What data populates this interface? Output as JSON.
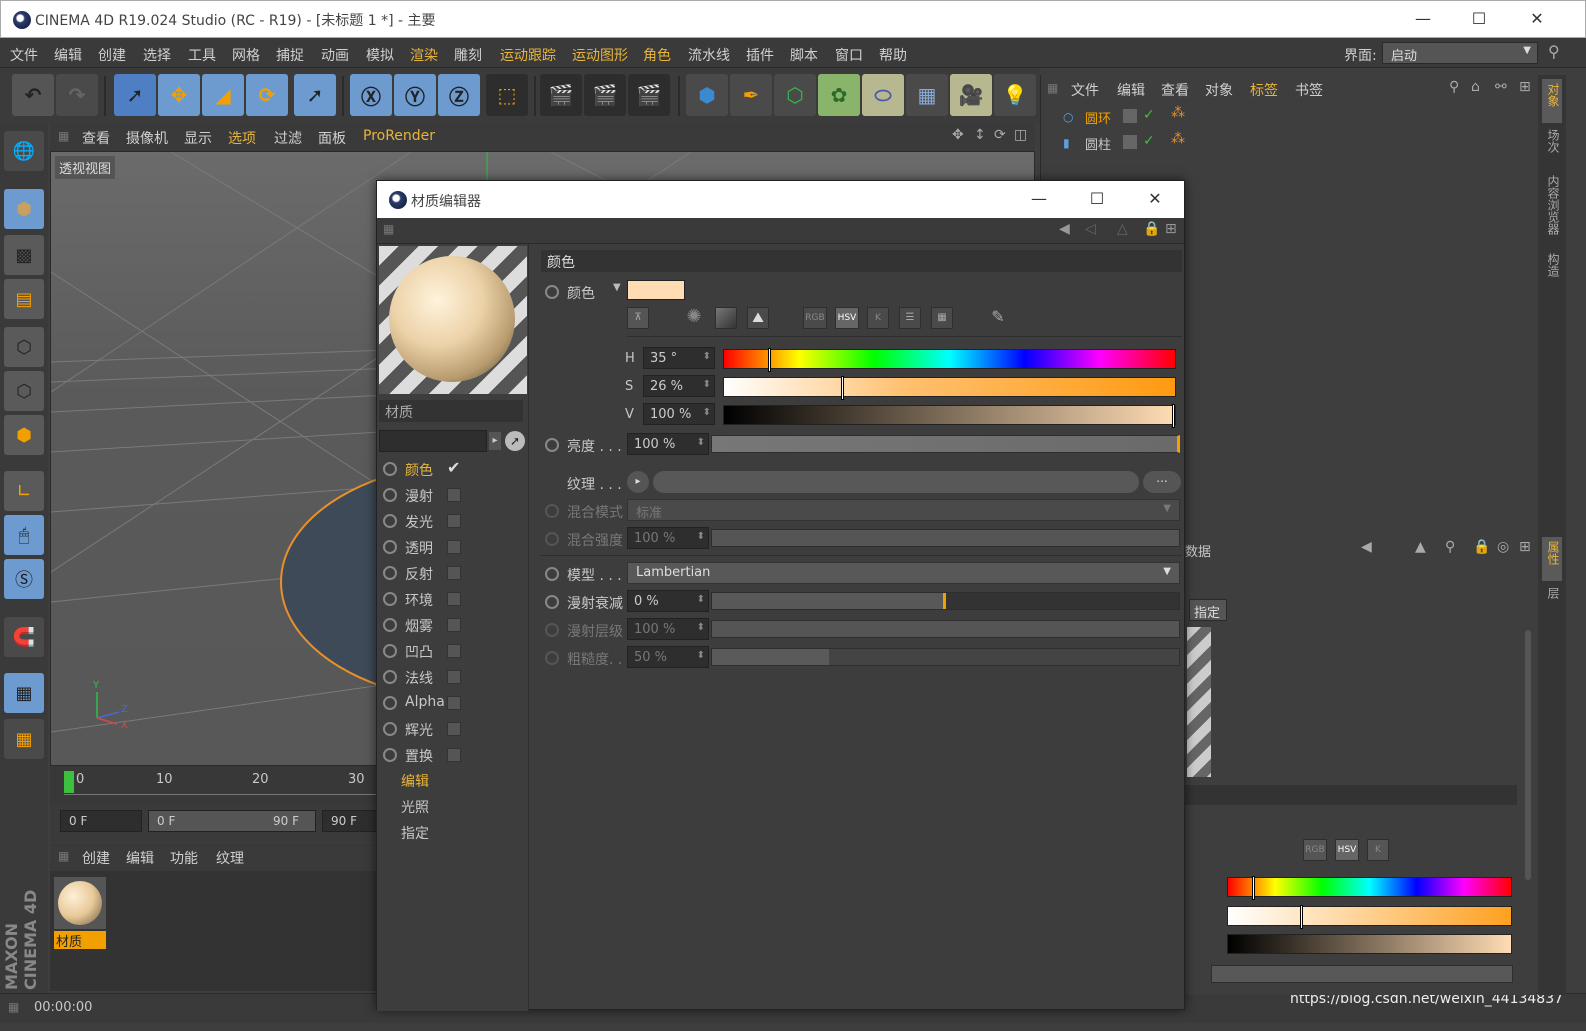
{
  "app": {
    "title": "CINEMA 4D R19.024 Studio (RC - R19) - [未标题 1 *] - 主要",
    "min": "—",
    "max": "☐",
    "close": "✕"
  },
  "menubar": {
    "items": [
      "文件",
      "编辑",
      "创建",
      "选择",
      "工具",
      "网格",
      "捕捉",
      "动画",
      "模拟",
      "渲染",
      "雕刻",
      "运动跟踪",
      "运动图形",
      "角色",
      "流水线",
      "插件",
      "脚本",
      "窗口",
      "帮助"
    ],
    "layout_label": "界面:",
    "layout_value": "启动"
  },
  "viewport": {
    "menu": [
      "查看",
      "摄像机",
      "显示",
      "选项",
      "过滤",
      "面板",
      "ProRender"
    ],
    "label": "透视视图",
    "axis_y": "Y",
    "axis_z": "Z",
    "axis_x": "X"
  },
  "timeline": {
    "ticks": [
      "0",
      "10",
      "20",
      "30"
    ],
    "start_field": "0 F",
    "range_start": "0 F",
    "range_end": "90 F",
    "end_field": "90 F"
  },
  "material_manager": {
    "menu": [
      "创建",
      "编辑",
      "功能",
      "纹理"
    ],
    "material_name": "材质"
  },
  "statusbar": {
    "time": "00:00:00",
    "watermark": "https://blog.csdn.net/weixin_44134837"
  },
  "object_manager": {
    "menu": [
      "文件",
      "编辑",
      "查看",
      "对象",
      "标签",
      "书签"
    ],
    "objects": [
      {
        "name": "圆环",
        "icon": "torus-icon",
        "selected": true
      },
      {
        "name": "圆柱",
        "icon": "cylinder-icon",
        "selected": false
      }
    ]
  },
  "attribute_manager": {
    "title_fragment": "数据",
    "assign_button": "指定",
    "rgb": "RGB",
    "hsv": "HSV",
    "k": "K"
  },
  "right_tabs": [
    "对象",
    "场次",
    "内容浏览器",
    "构造",
    "属性",
    "层"
  ],
  "material_editor": {
    "title": "材质编辑器",
    "min": "—",
    "max": "☐",
    "close": "✕",
    "material_name": "材质",
    "channels": [
      {
        "label": "颜色",
        "checked": true,
        "active": true
      },
      {
        "label": "漫射",
        "checked": false
      },
      {
        "label": "发光",
        "checked": false
      },
      {
        "label": "透明",
        "checked": false
      },
      {
        "label": "反射",
        "checked": false
      },
      {
        "label": "环境",
        "checked": false
      },
      {
        "label": "烟雾",
        "checked": false
      },
      {
        "label": "凹凸",
        "checked": false
      },
      {
        "label": "法线",
        "checked": false
      },
      {
        "label": "Alpha",
        "checked": false
      },
      {
        "label": "辉光",
        "checked": false
      },
      {
        "label": "置换",
        "checked": false
      }
    ],
    "links": [
      "编辑",
      "光照",
      "指定"
    ],
    "section_title": "颜色",
    "color_label": "颜色",
    "swatch_color": "#ffdcb4",
    "rgb": "RGB",
    "hsv": "HSV",
    "k": "K",
    "h": {
      "key": "H",
      "value": "35 °",
      "fraction": 0.097
    },
    "s": {
      "key": "S",
      "value": "26 %",
      "fraction": 0.26
    },
    "v": {
      "key": "V",
      "value": "100 %",
      "fraction": 1.0
    },
    "brightness": {
      "label": "亮度 . . .",
      "value": "100 %"
    },
    "texture": {
      "label": "纹理 . . .",
      "button": "..."
    },
    "blend_mode": {
      "label": "混合模式",
      "value": "标准"
    },
    "blend_strength": {
      "label": "混合强度",
      "value": "100 %"
    },
    "model": {
      "label": "模型 . . .",
      "value": "Lambertian"
    },
    "diffuse_falloff": {
      "label": "漫射衰减",
      "value": "0 %",
      "fraction": 0.5
    },
    "diffuse_level": {
      "label": "漫射层级",
      "value": "100 %"
    },
    "roughness": {
      "label": "粗糙度. .",
      "value": "50 %",
      "fraction": 0.25
    }
  }
}
